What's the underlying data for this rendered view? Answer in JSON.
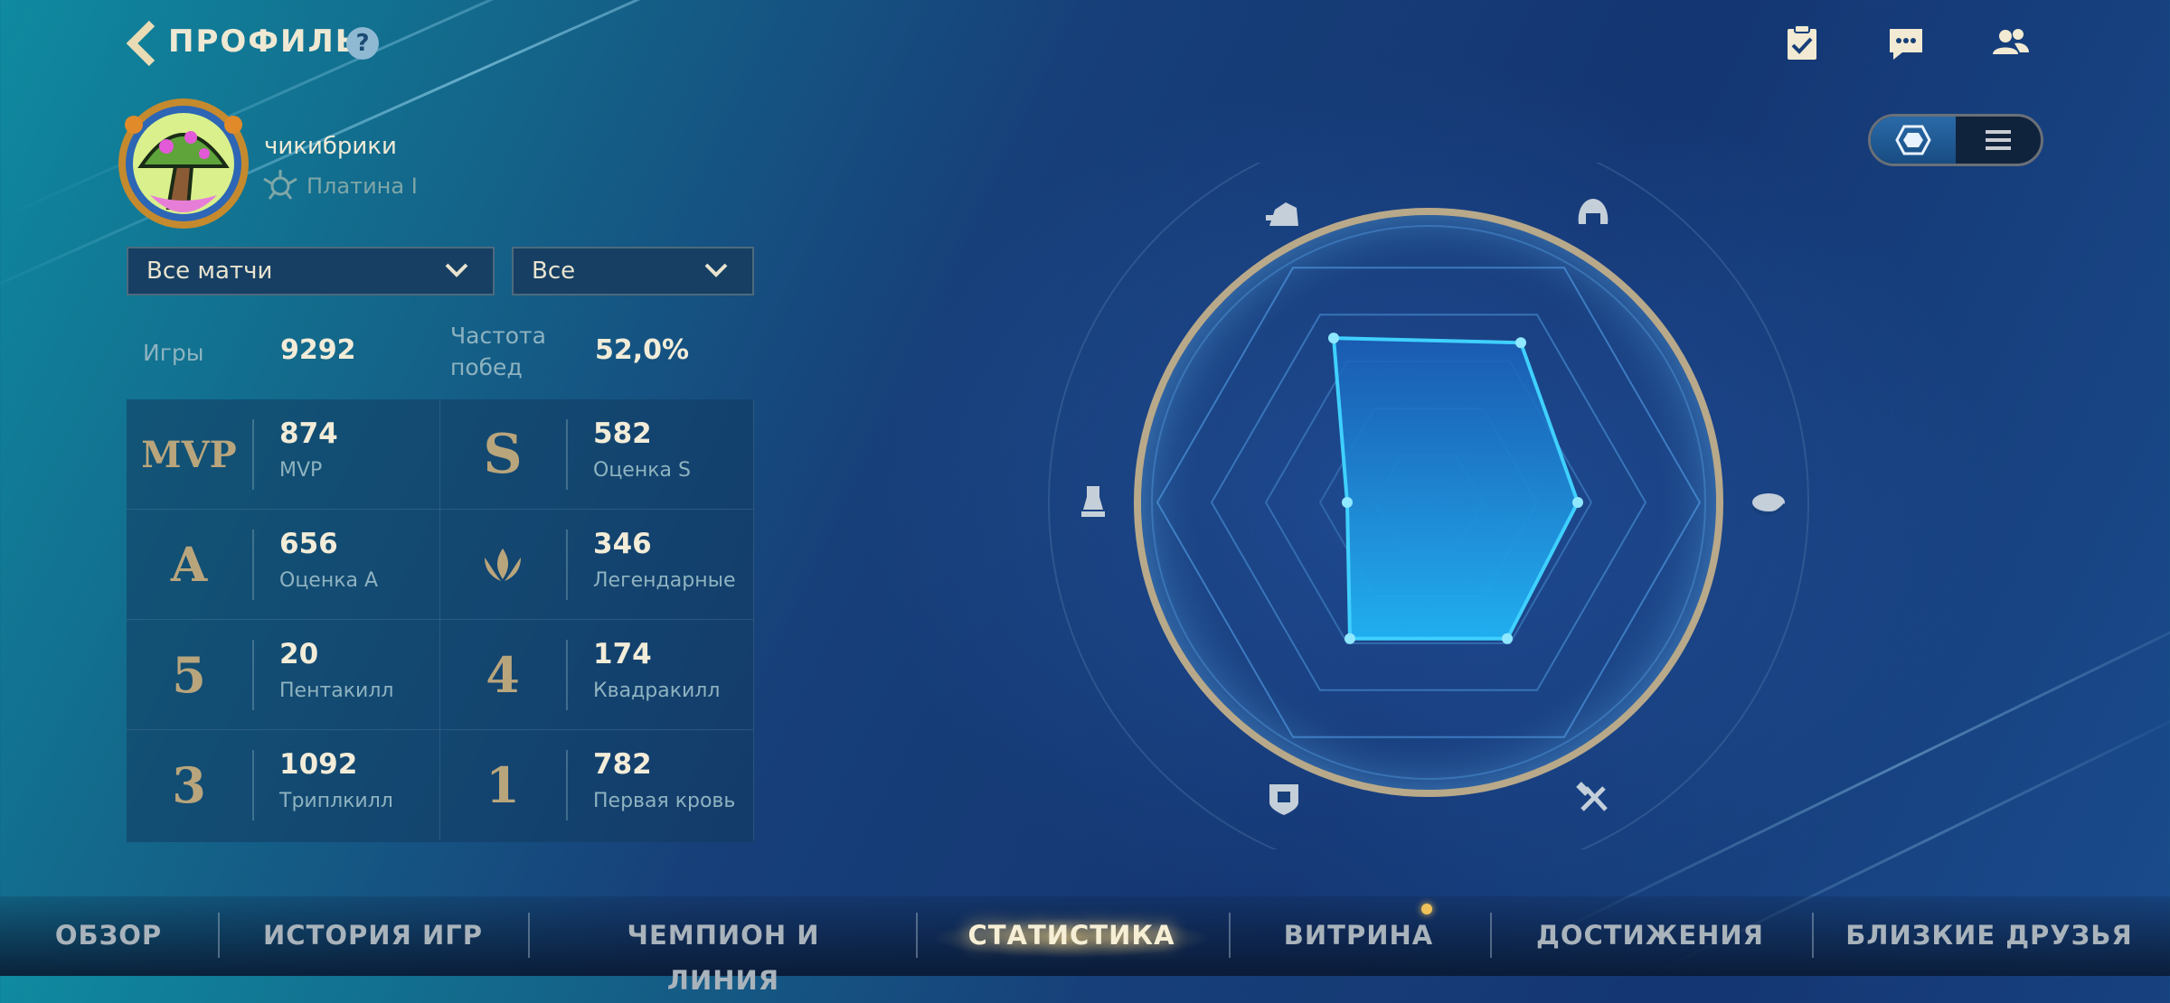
{
  "header": {
    "back_icon": "chevron-left-icon",
    "title": "ПРОФИЛЬ",
    "help_label": "?",
    "top_icons": [
      "clipboard-check-icon",
      "chat-icon",
      "friends-icon"
    ]
  },
  "profile": {
    "username": "чикибрики",
    "rank": "Платина I",
    "avatar_icon": "mushroom-avatar-icon",
    "rank_icon": "platinum-emblem-icon"
  },
  "filters": {
    "match_type": "Все матчи",
    "champion_filter": "Все"
  },
  "summary": {
    "games_label": "Игры",
    "games_value": "9292",
    "winrate_label_line1": "Частота",
    "winrate_label_line2": "побед",
    "winrate_value": "52,0%"
  },
  "stats": [
    {
      "icon_text": "MVP",
      "icon": "mvp-icon",
      "value": "874",
      "label": "MVP"
    },
    {
      "icon_text": "S",
      "icon": "grade-s-icon",
      "value": "582",
      "label": "Оценка S"
    },
    {
      "icon_text": "A",
      "icon": "grade-a-icon",
      "value": "656",
      "label": "Оценка A"
    },
    {
      "icon_text": "",
      "icon": "legendary-crown-icon",
      "value": "346",
      "label": "Легендарные"
    },
    {
      "icon_text": "5",
      "icon": "pentakill-icon",
      "value": "20",
      "label": "Пентакилл"
    },
    {
      "icon_text": "4",
      "icon": "quadrakill-icon",
      "value": "174",
      "label": "Квадракилл"
    },
    {
      "icon_text": "3",
      "icon": "triplekill-icon",
      "value": "1092",
      "label": "Триплкилл"
    },
    {
      "icon_text": "1",
      "icon": "first-blood-icon",
      "value": "782",
      "label": "Первая кровь"
    }
  ],
  "view_toggle": {
    "active": "radar-view-icon",
    "inactive": "list-view-icon"
  },
  "radar": {
    "axes_icons": [
      "fighter-icon",
      "mage-helmet-icon",
      "ward-icon",
      "tools-icon",
      "shield-icon",
      "chess-icon"
    ],
    "values": [
      0.7,
      0.68,
      0.55,
      0.58,
      0.58,
      0.3
    ],
    "accent_color": "#3fd0ff",
    "ring_color": "#b8a98a"
  },
  "nav": {
    "tabs": [
      "ОБЗОР",
      "ИСТОРИЯ ИГР",
      "ЧЕМПИОН И ЛИНИЯ",
      "СТАТИСТИКА",
      "ВИТРИНА",
      "ДОСТИЖЕНИЯ",
      "БЛИЗКИЕ ДРУЗЬЯ"
    ],
    "active_tab": "СТАТИСТИКА",
    "notification_tab": "ВИТРИНА"
  }
}
